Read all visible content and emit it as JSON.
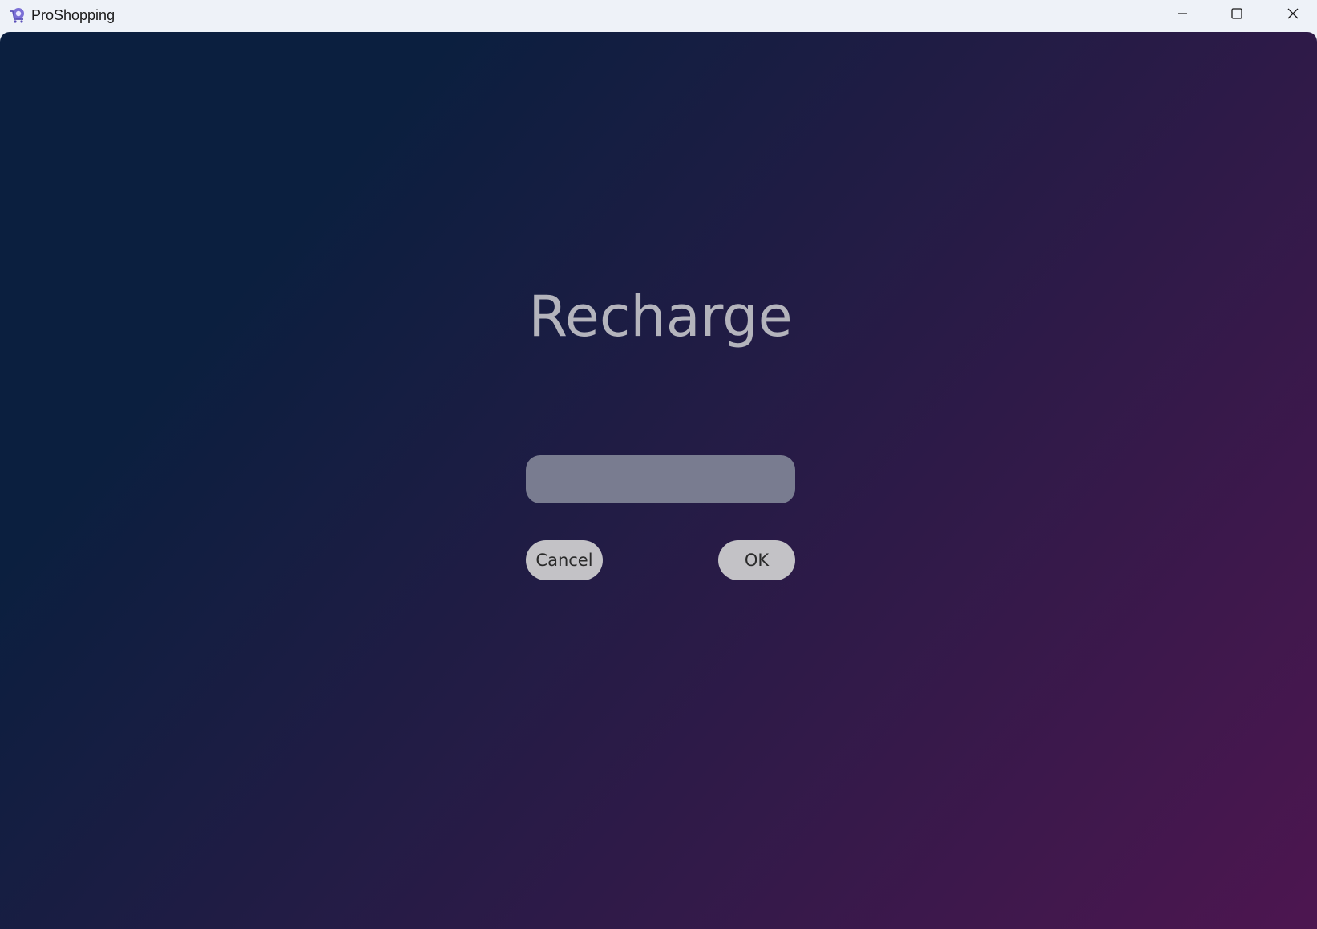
{
  "window": {
    "title": "ProShopping",
    "icon": "shopping-cart-icon",
    "controls": {
      "minimize": "minimize-icon",
      "maximize": "maximize-icon",
      "close": "close-icon"
    }
  },
  "dialog": {
    "heading": "Recharge",
    "amount_input": {
      "value": "",
      "placeholder": ""
    },
    "cancel_label": "Cancel",
    "ok_label": "OK"
  },
  "colors": {
    "gradient_start": "#0b1f3f",
    "gradient_end": "#4d1650",
    "heading": "#b4b4bc",
    "input_bg": "#797c90",
    "button_bg": "#c3c2c6"
  }
}
